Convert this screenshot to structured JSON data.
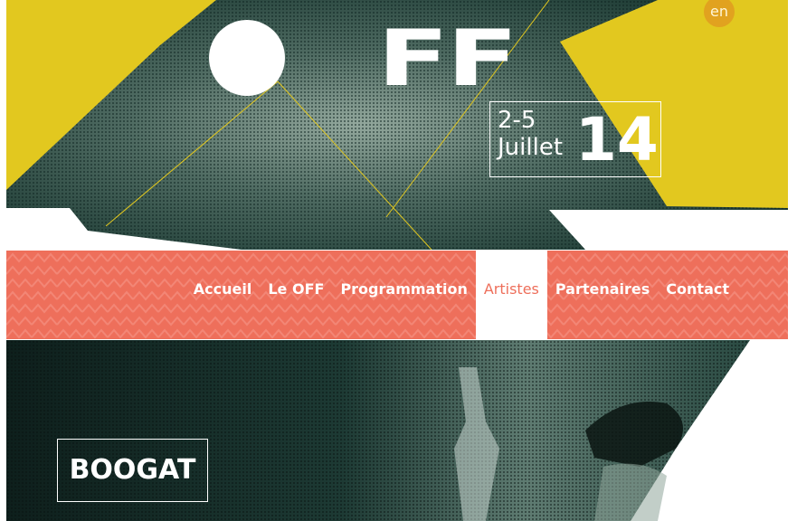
{
  "hero": {
    "logo": "FF",
    "date_range": "2-5",
    "date_month": "Juillet",
    "date_year": "14",
    "language_button": "en"
  },
  "nav": {
    "items": [
      {
        "label": "Accueil"
      },
      {
        "label": "Le OFF"
      },
      {
        "label": "Programmation"
      },
      {
        "label": "Artistes",
        "active": true
      },
      {
        "label": "Partenaires"
      },
      {
        "label": "Contact"
      }
    ]
  },
  "artist": {
    "name": "BOOGAT"
  },
  "colors": {
    "yellow": "#e2c81f",
    "coral": "#ee6f5b",
    "teal_dark": "#1a3330",
    "orange": "#e1a21f"
  }
}
